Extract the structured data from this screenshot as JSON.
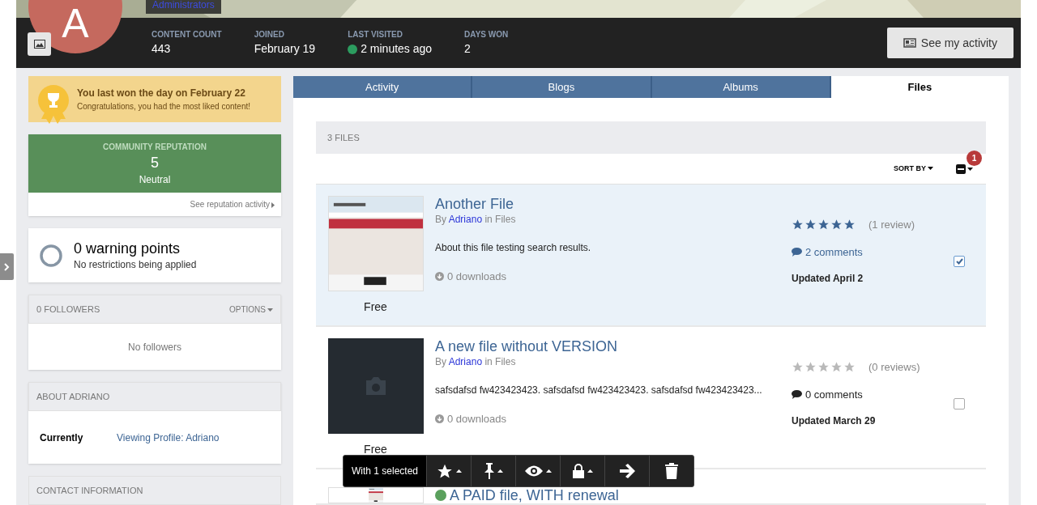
{
  "header": {
    "group": "Administrators",
    "avatar_letter": "A",
    "stats": [
      {
        "label": "CONTENT COUNT",
        "value": "443",
        "online": false
      },
      {
        "label": "JOINED",
        "value": "February 19",
        "online": false
      },
      {
        "label": "LAST VISITED",
        "value": "2 minutes ago",
        "online": true
      },
      {
        "label": "DAYS WON",
        "value": "2",
        "online": false
      }
    ],
    "activity_button": "See my activity"
  },
  "sidebar": {
    "day_won": {
      "title": "You last won the day on February 22",
      "text": "Congratulations, you had the most liked content!"
    },
    "reputation": {
      "label": "COMMUNITY REPUTATION",
      "value": "5",
      "level_name": "Neutral",
      "link": "See reputation activity"
    },
    "warnings": {
      "title": "0 warning points",
      "text": "No restrictions being applied"
    },
    "followers": {
      "title": "0 FOLLOWERS",
      "options": "OPTIONS",
      "empty": "No followers"
    },
    "about": {
      "title": "ABOUT ADRIANO",
      "fields": [
        {
          "label": "Currently",
          "value": "Viewing Profile: Adriano"
        }
      ]
    },
    "contact": {
      "title": "CONTACT INFORMATION"
    }
  },
  "tabs": [
    {
      "label": "Activity",
      "selected": false
    },
    {
      "label": "Blogs",
      "selected": false
    },
    {
      "label": "Albums",
      "selected": false
    },
    {
      "label": "Files",
      "selected": true
    }
  ],
  "files": {
    "count": "3 FILES",
    "sort": "SORT BY",
    "badge": "1",
    "items": [
      {
        "title": "Another File",
        "by": "By",
        "author": "Adriano",
        "in": "in Files",
        "description": "About this file testing search results.",
        "downloads": "0 downloads",
        "price": "Free",
        "stars": 5,
        "reviews": "(1 review)",
        "comments": "2 comments",
        "updated": "Updated April 2",
        "checked": true,
        "has_image": true
      },
      {
        "title": "A new file without VERSION",
        "by": "By",
        "author": "Adriano",
        "in": "in Files",
        "description": "safsdafsd fw423423423. safsdafsd fw423423423. safsdafsd fw423423423...",
        "downloads": "0 downloads",
        "price": "Free",
        "stars": 0,
        "reviews": "(0 reviews)",
        "comments": "0 comments",
        "updated": "Updated March 29",
        "checked": false,
        "has_image": false
      },
      {
        "title": "A PAID file, WITH renewal",
        "has_image": true,
        "partial": true
      }
    ]
  },
  "moderation_bar": {
    "selected_text": "With 1 selected"
  }
}
